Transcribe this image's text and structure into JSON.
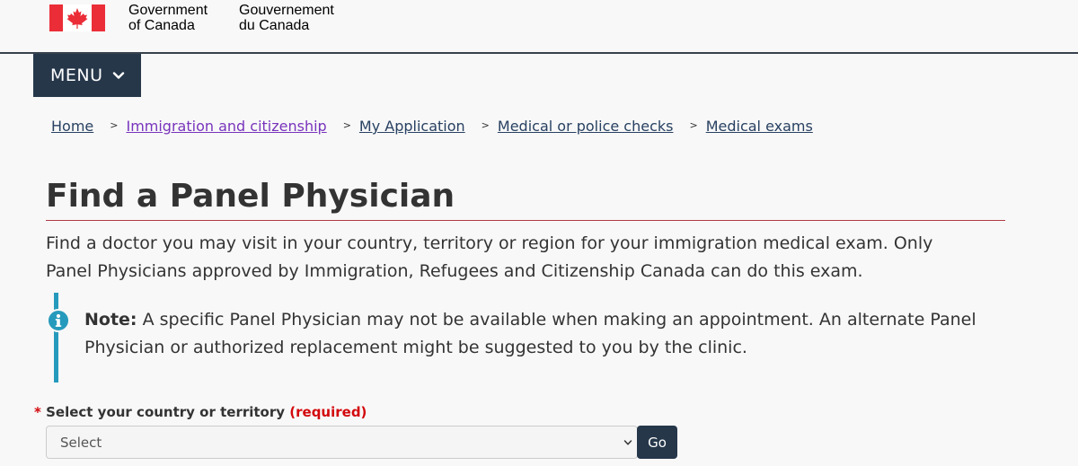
{
  "header": {
    "signature_en": [
      "Government",
      "of Canada"
    ],
    "signature_fr": [
      "Gouvernement",
      "du Canada"
    ],
    "flag_icon": "canada-flag-icon"
  },
  "menu": {
    "label": "MENU",
    "icon": "chevron-down-icon"
  },
  "breadcrumb": {
    "separator": ">",
    "items": [
      {
        "label": "Home",
        "visited": false
      },
      {
        "label": "Immigration and citizenship",
        "visited": true
      },
      {
        "label": "My Application",
        "visited": false
      },
      {
        "label": "Medical or police checks",
        "visited": false
      },
      {
        "label": "Medical exams",
        "visited": false
      }
    ]
  },
  "main": {
    "title": "Find a Panel Physician",
    "intro": "Find a doctor you may visit in your country, territory or region for your immigration medical exam. Only Panel Physicians approved by Immigration, Refugees and Citizenship Canada can do this exam.",
    "note": {
      "icon": "info-icon",
      "label": "Note:",
      "text": "A specific Panel Physician may not be available when making an appointment. An alternate Panel Physician or authorized replacement might be suggested to you by the clinic."
    }
  },
  "form": {
    "required_marker": "*",
    "label": "Select your country or territory",
    "required_text": "(required)",
    "select_value": "Select",
    "go_label": "Go"
  },
  "colors": {
    "brand_dark": "#26374a",
    "flag_red": "#eb2d37",
    "info_blue": "#269abc",
    "required_red": "#d3080c",
    "visited_link": "#7834bc",
    "link": "#284162",
    "title_rule": "#af3c43"
  }
}
